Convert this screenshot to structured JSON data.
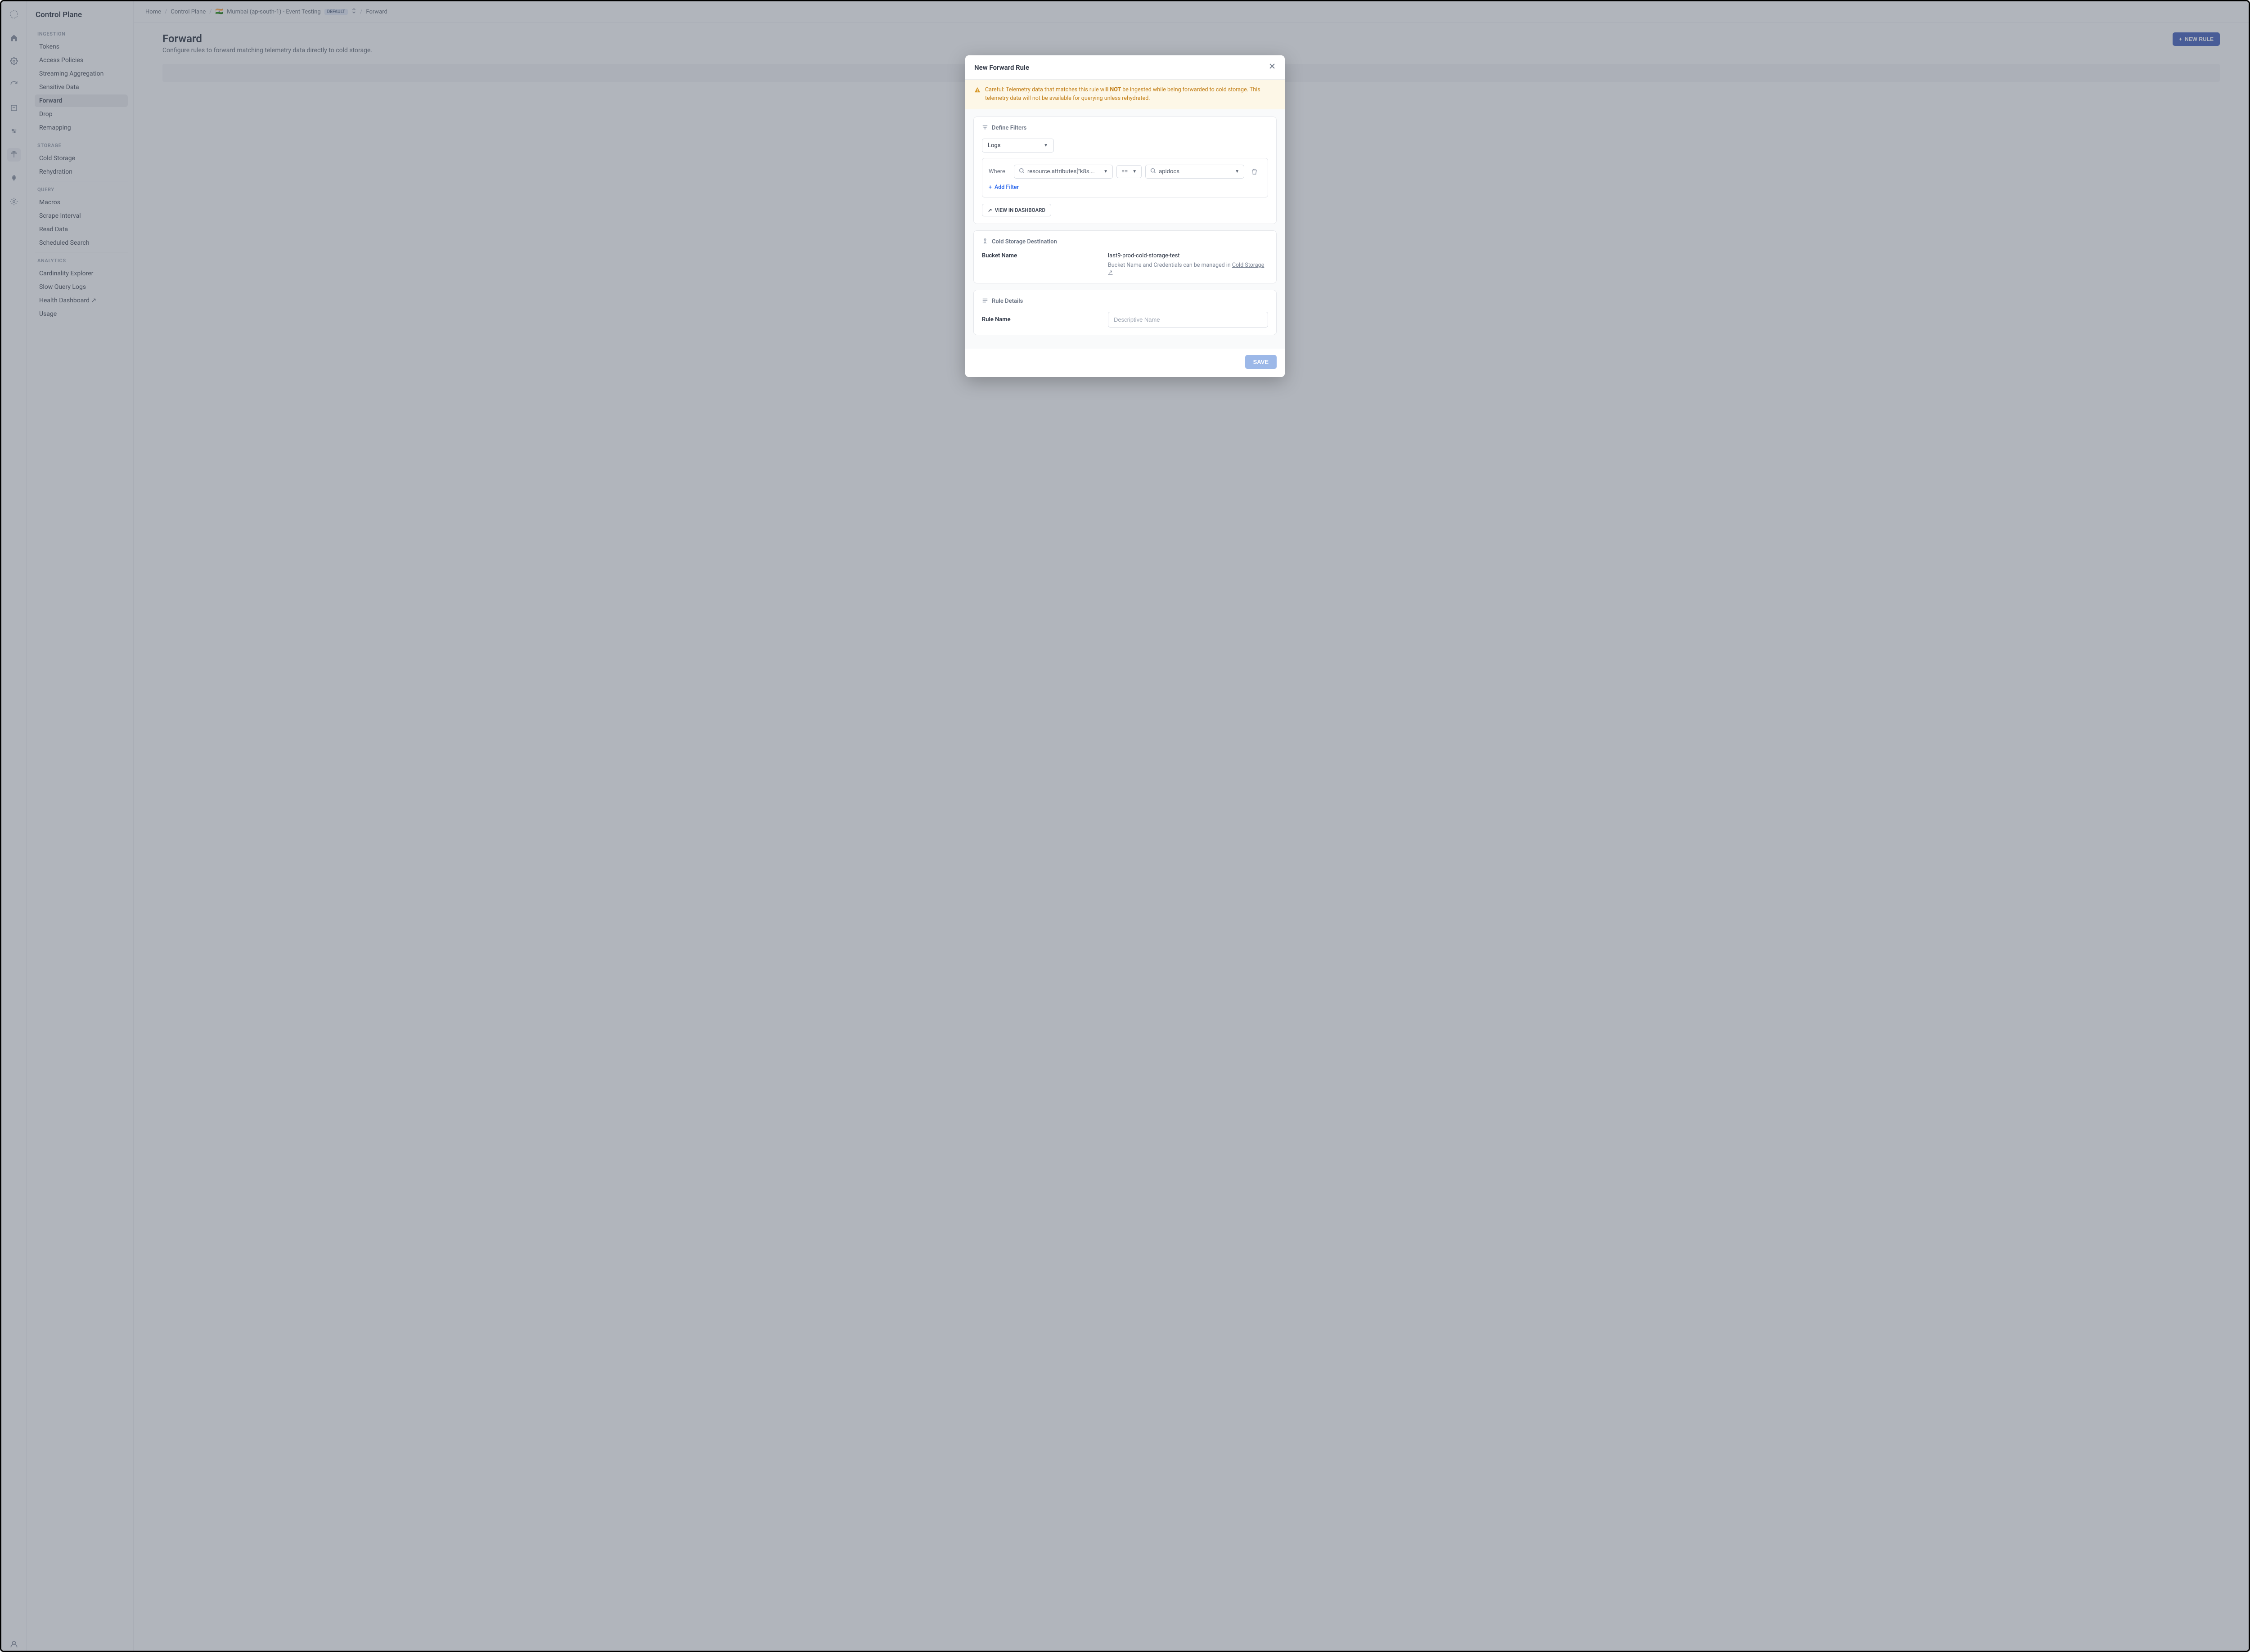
{
  "sidebar": {
    "title": "Control Plane",
    "sections": [
      {
        "label": "INGESTION",
        "items": [
          "Tokens",
          "Access Policies",
          "Streaming Aggregation",
          "Sensitive Data",
          "Forward",
          "Drop",
          "Remapping"
        ],
        "active_index": 4
      },
      {
        "label": "STORAGE",
        "items": [
          "Cold Storage",
          "Rehydration"
        ]
      },
      {
        "label": "QUERY",
        "items": [
          "Macros",
          "Scrape Interval",
          "Read Data",
          "Scheduled Search"
        ]
      },
      {
        "label": "ANALYTICS",
        "items": [
          "Cardinality Explorer",
          "Slow Query Logs",
          "Health Dashboard ↗",
          "Usage"
        ]
      }
    ]
  },
  "breadcrumb": {
    "home": "Home",
    "cp": "Control Plane",
    "flag": "🇮🇳",
    "env": "Mumbai (ap-south-1) - Event Testing",
    "badge": "DEFAULT",
    "page": "Forward"
  },
  "page": {
    "title": "Forward",
    "subtitle": "Configure rules to forward matching telemetry data directly to cold storage.",
    "new_rule": "NEW RULE"
  },
  "modal": {
    "title": "New Forward Rule",
    "warning_prefix": "Careful: Telemetry data that matches this rule will ",
    "warning_not": "NOT",
    "warning_suffix": " be ingested while being forwarded to cold storage. This telemetry data will not be available for querying unless rehydrated.",
    "filters": {
      "header": "Define Filters",
      "type": "Logs",
      "where": "Where",
      "attribute": "resource.attributes[\"k8s..name...",
      "operator": "==",
      "value": "apidocs",
      "add_filter": "Add Filter",
      "view_dashboard": "VIEW IN DASHBOARD"
    },
    "destination": {
      "header": "Cold Storage Destination",
      "bucket_label": "Bucket Name",
      "bucket_value": "last9-prod-cold-storage-test",
      "hint_prefix": "Bucket Name and Credentials can be managed in ",
      "hint_link": "Cold Storage ↗"
    },
    "details": {
      "header": "Rule Details",
      "name_label": "Rule Name",
      "name_placeholder": "Descriptive Name"
    },
    "save": "SAVE"
  }
}
